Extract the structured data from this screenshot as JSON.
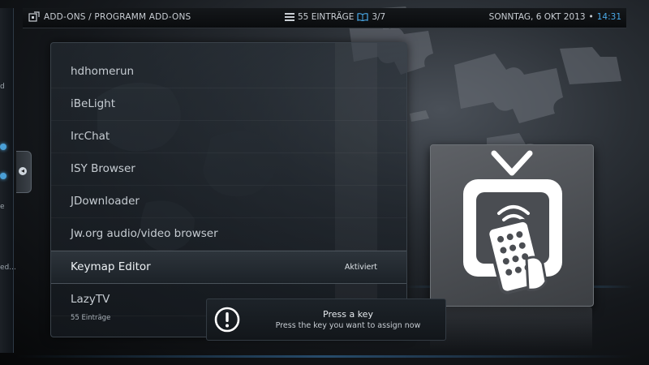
{
  "header": {
    "breadcrumb": "ADD-ONS / PROGRAMM ADD-ONS",
    "items_count": "55 EINTRÄGE",
    "page": "3/7",
    "date": "SONNTAG, 6 OKT 2013",
    "separator": "•",
    "time": "14:31",
    "accent_color": "#4aa9e8"
  },
  "left_strip": {
    "fragments": [
      "d",
      "e",
      "ed..."
    ]
  },
  "list": {
    "items": [
      {
        "label": "hdhomerun",
        "status": ""
      },
      {
        "label": "iBeLight",
        "status": ""
      },
      {
        "label": "IrcChat",
        "status": ""
      },
      {
        "label": "ISY Browser",
        "status": ""
      },
      {
        "label": "JDownloader",
        "status": ""
      },
      {
        "label": "Jw.org audio/video browser",
        "status": ""
      },
      {
        "label": "Keymap Editor",
        "status": "Aktiviert"
      },
      {
        "label": "LazyTV",
        "status": ""
      }
    ],
    "footer_count": "55 Einträge"
  },
  "notification": {
    "title": "Press a key",
    "message": "Press the key you want to assign now",
    "icon": "exclamation-circle-icon"
  },
  "thumbnail": {
    "icon": "tv-remote-icon"
  }
}
